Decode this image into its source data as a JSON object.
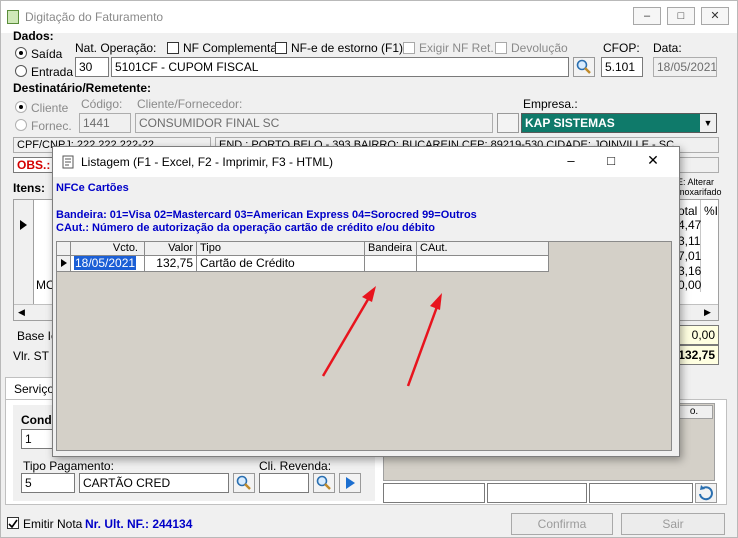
{
  "window": {
    "title": "Digitação do Faturamento"
  },
  "dados": {
    "section_label": "Dados:",
    "saida_label": "Saída",
    "entrada_label": "Entrada",
    "nat_op_label": "Nat. Operação:",
    "nat_op_code": "30",
    "nat_op_desc": "5101CF - CUPOM FISCAL",
    "nf_complementar": "NF Complementar",
    "nfe_estorno": "NF-e de estorno (F1)",
    "exigir_nf_ret": "Exigir NF Ret.",
    "devolucao": "Devolução",
    "cfop_label": "CFOP:",
    "cfop_value": "5.101",
    "data_label": "Data:",
    "data_value": "18/05/2021"
  },
  "dest": {
    "section_label": "Destinatário/Remetente:",
    "cliente_label": "Cliente",
    "fornec_label": "Fornec.",
    "codigo_label": "Código:",
    "codigo_value": "1441",
    "cli_forn_label": "Cliente/Fornecedor:",
    "cli_forn_value": "CONSUMIDOR FINAL SC",
    "empresa_label": "Empresa.:",
    "empresa_value": "KAP SISTEMAS",
    "cpf_text": "CPF/CNPJ: 222.222.222-22",
    "end_text": "END.: PORTO BELO - 393 BAIRRO: BUCAREIN CEP: 89219-530 CIDADE: JOINVILLE - SC",
    "obs_text": "OBS.: C"
  },
  "itens": {
    "section_label": "Itens:",
    "alterar_label": "E: Alterar",
    "almox_label": "moxarifado",
    "col_total": "otal",
    "col_pct": "%I",
    "totals": [
      "4,47",
      "3,11",
      "7,01",
      "3,16",
      "0,00"
    ],
    "mo_text": "MO",
    "base_label": "Base Ic",
    "vlr_st_label": "Vlr. ST F",
    "base_value": "0,00",
    "vlr_st_value": "132,75"
  },
  "servicos": {
    "tab_label": "Serviços",
    "cond_label": "Cond",
    "cond_value": "1",
    "tipo_pag_label": "Tipo Pagamento:",
    "tipo_pag_code": "5",
    "tipo_pag_desc": "CARTÃO CRED",
    "cli_revenda_label": "Cli. Revenda:"
  },
  "footer": {
    "emitir_nota_label": "Emitir Nota",
    "ult_nf_label": "Nr. Ult. NF.: 244134",
    "confirma_label": "Confirma",
    "sair_label": "Sair"
  },
  "modal": {
    "title": "Listagem (F1 - Excel, F2 - Imprimir, F3 - HTML)",
    "heading": "NFCe Cartões",
    "bandeira_line": "Bandeira: 01=Visa 02=Mastercard 03=American Express 04=Sorocred 99=Outros",
    "caut_line": "CAut.: Número de autorização da operação cartão de crédito e/ou débito",
    "columns": [
      "Vcto.",
      "Valor",
      "Tipo",
      "Bandeira",
      "CAut."
    ],
    "row": {
      "vcto": "18/05/2021",
      "valor": "132,75",
      "tipo": "Cartão de Crédito",
      "bandeira": "",
      "caut": ""
    }
  },
  "colors": {
    "accent_blue": "#0000c8",
    "empresa_bg": "#0f7a6a",
    "obs_red": "#d40000",
    "arrow_red": "#e8141e"
  }
}
